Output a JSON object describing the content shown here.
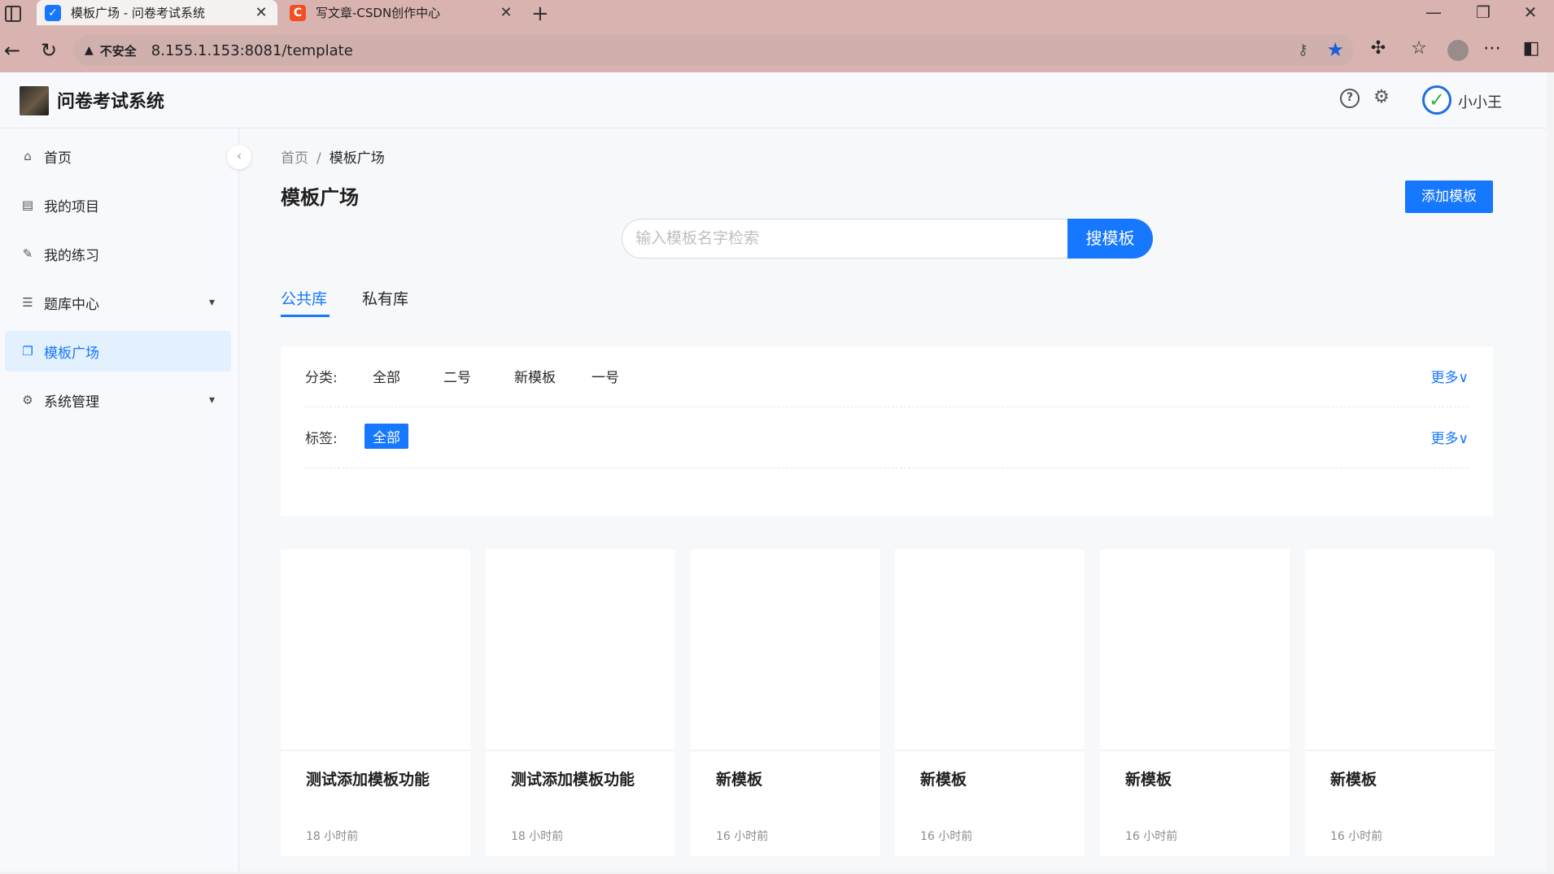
{
  "browser": {
    "tabs": [
      {
        "title": "模板广场 - 问卷考试系统",
        "favicon": "check-favicon",
        "active": true
      },
      {
        "title": "写文章-CSDN创作中心",
        "favicon": "csdn-favicon",
        "favicon_letter": "C",
        "active": false
      }
    ],
    "insecure_label": "不安全",
    "url": "8.155.1.153:8081/template"
  },
  "header": {
    "app_name": "问卷考试系统",
    "username": "小小王"
  },
  "sidebar": {
    "items": [
      {
        "label": "首页",
        "icon": "home-icon"
      },
      {
        "label": "我的项目",
        "icon": "project-icon"
      },
      {
        "label": "我的练习",
        "icon": "edit-icon"
      },
      {
        "label": "题库中心",
        "icon": "question-bank-icon",
        "expandable": true
      },
      {
        "label": "模板广场",
        "icon": "template-icon",
        "active": true
      },
      {
        "label": "系统管理",
        "icon": "settings-icon",
        "expandable": true
      }
    ]
  },
  "main": {
    "breadcrumb": {
      "home": "首页",
      "separator": "/",
      "current": "模板广场"
    },
    "title": "模板广场",
    "add_button": "添加模板",
    "search": {
      "placeholder": "输入模板名字检索",
      "button": "搜模板"
    },
    "tabs": [
      {
        "label": "公共库",
        "active": true
      },
      {
        "label": "私有库",
        "active": false
      }
    ],
    "filters": {
      "category": {
        "label": "分类:",
        "options": [
          "全部",
          "二号",
          "新模板",
          "一号"
        ],
        "more": "更多"
      },
      "tag": {
        "label": "标签:",
        "options": [
          "全部"
        ],
        "selected": "全部",
        "more": "更多"
      }
    },
    "cards": [
      {
        "name": "测试添加模板功能",
        "time": "18 小时前"
      },
      {
        "name": "测试添加模板功能",
        "time": "18 小时前"
      },
      {
        "name": "新模板",
        "time": "16 小时前"
      },
      {
        "name": "新模板",
        "time": "16 小时前"
      },
      {
        "name": "新模板",
        "time": "16 小时前"
      },
      {
        "name": "新模板",
        "time": "16 小时前"
      }
    ]
  },
  "colors": {
    "accent": "#1677ff",
    "chrome": "#d9b3b0",
    "active_menu_bg": "#e3f0fd"
  }
}
